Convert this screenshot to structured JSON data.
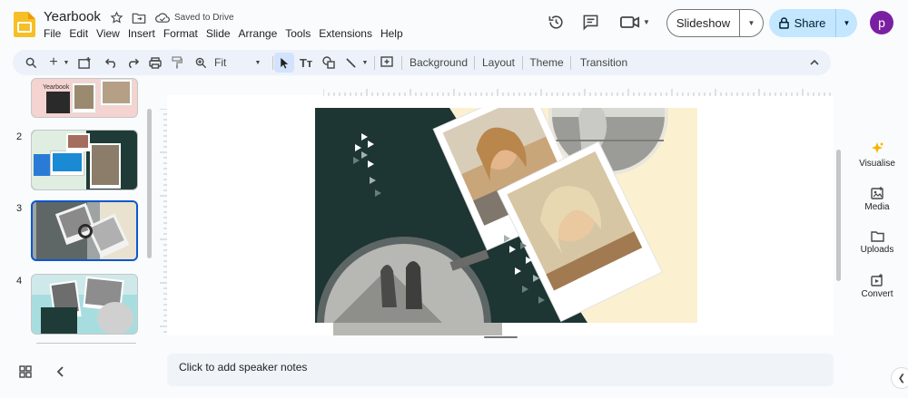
{
  "app": {
    "doc_title": "Yearbook",
    "saved_status": "Saved to Drive",
    "avatar_letter": "p",
    "brand_color": "#f6bf26",
    "accent_color": "#c2e7ff"
  },
  "menu": [
    "File",
    "Edit",
    "View",
    "Insert",
    "Format",
    "Slide",
    "Arrange",
    "Tools",
    "Extensions",
    "Help"
  ],
  "header_actions": {
    "slideshow_label": "Slideshow",
    "share_label": "Share",
    "icons": [
      "history-icon",
      "comment-icon",
      "meet-icon",
      "lock-icon"
    ]
  },
  "toolbar": {
    "zoom_value": "Fit",
    "background_label": "Background",
    "layout_label": "Layout",
    "theme_label": "Theme",
    "transition_label": "Transition"
  },
  "filmstrip": {
    "numbers": [
      "2",
      "3",
      "4"
    ],
    "first_thumb_text": "Yearbook",
    "selected_slide": 3
  },
  "notes": {
    "placeholder": "Click to add speaker notes"
  },
  "side_panel": {
    "items": [
      {
        "label": "Visualise",
        "icon": "sparkle-icon"
      },
      {
        "label": "Media",
        "icon": "media-icon"
      },
      {
        "label": "Uploads",
        "icon": "folder-icon"
      },
      {
        "label": "Convert",
        "icon": "convert-icon"
      }
    ]
  }
}
